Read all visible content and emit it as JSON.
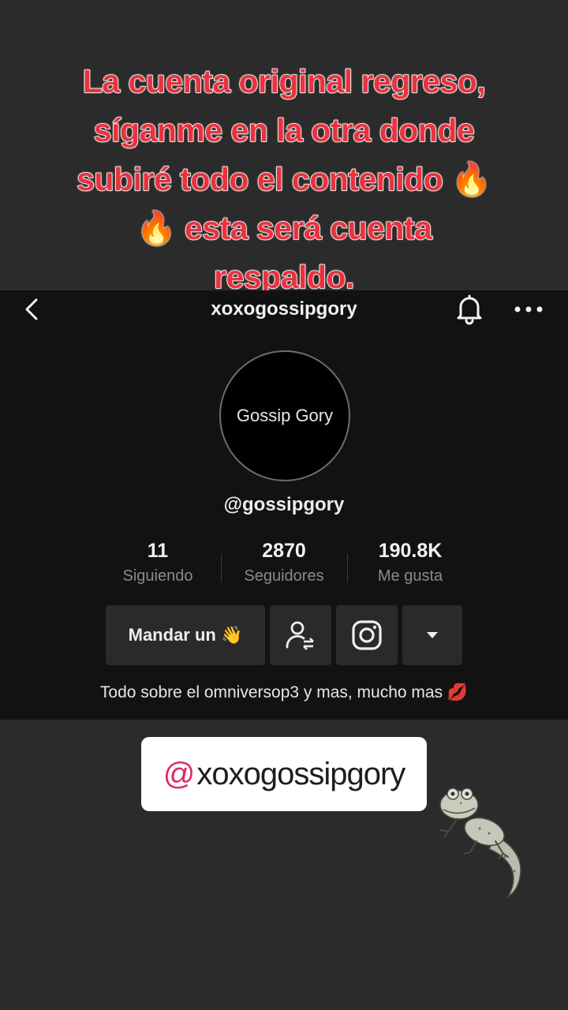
{
  "caption": {
    "line1": "La cuenta original regreso,",
    "line2": "síganme en la otra donde",
    "line3": "subiré todo el contenido 🔥",
    "line4": "🔥 esta será cuenta",
    "line5": "respaldo."
  },
  "header": {
    "title": "xoxogossipgory"
  },
  "profile": {
    "avatar_text": "Gossip Gory",
    "username": "@gossipgory",
    "stats": [
      {
        "value": "11",
        "label": "Siguiendo"
      },
      {
        "value": "2870",
        "label": "Seguidores"
      },
      {
        "value": "190.8K",
        "label": "Me gusta"
      }
    ],
    "message_button": "Mandar un 👋",
    "bio": "Todo sobre el omniversop3 y mas, mucho mas 💋"
  },
  "mention_sticker": {
    "at": "@",
    "handle": "xoxogossipgory"
  },
  "icons": [
    "back-icon",
    "bell-icon",
    "more-icon",
    "add-friend-icon",
    "instagram-icon",
    "dropdown-icon",
    "gecko-sticker"
  ],
  "colors": {
    "caption": "#e8333f",
    "mention_at": "#e02a63",
    "panel": "#121212",
    "background": "#2b2b2b"
  }
}
